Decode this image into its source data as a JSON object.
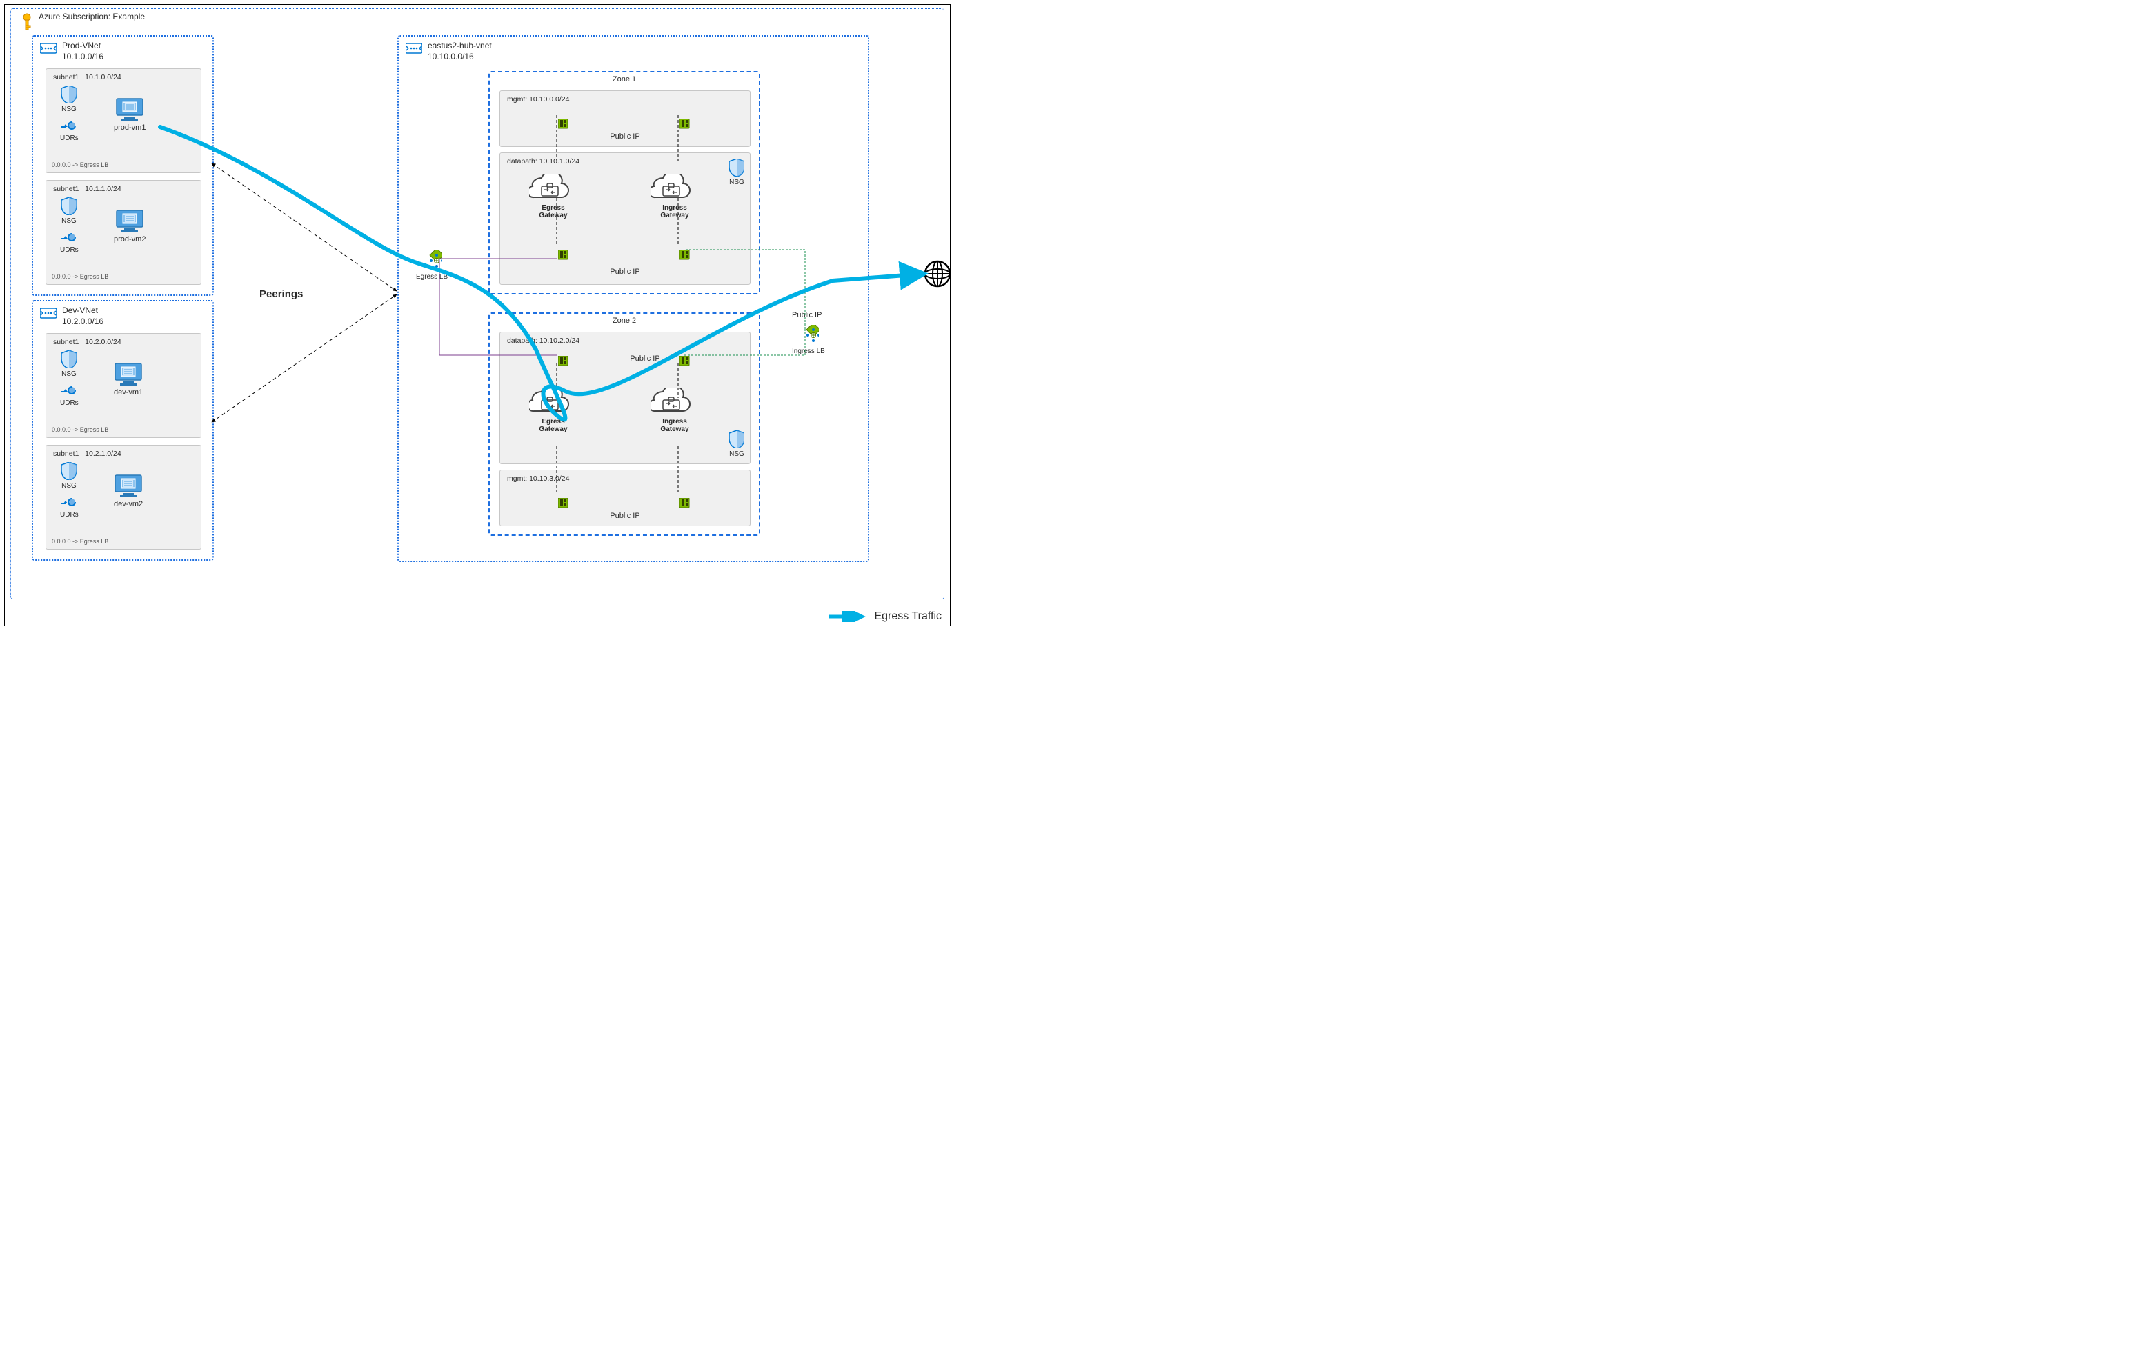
{
  "subscription": {
    "title": "Azure Subscription: Example"
  },
  "peerings_label": "Peerings",
  "legend_label": "Egress Traffic",
  "spoke_vnets": [
    {
      "name": "Prod-VNet",
      "cidr": "10.1.0.0/16",
      "subnets": [
        {
          "label": "subnet1",
          "cidr": "10.1.0.0/24",
          "nsg": "NSG",
          "udrs": "UDRs",
          "udr_note": "0.0.0.0 -> Egress LB",
          "vm": "prod-vm1"
        },
        {
          "label": "subnet1",
          "cidr": "10.1.1.0/24",
          "nsg": "NSG",
          "udrs": "UDRs",
          "udr_note": "0.0.0.0 -> Egress LB",
          "vm": "prod-vm2"
        }
      ]
    },
    {
      "name": "Dev-VNet",
      "cidr": "10.2.0.0/16",
      "subnets": [
        {
          "label": "subnet1",
          "cidr": "10.2.0.0/24",
          "nsg": "NSG",
          "udrs": "UDRs",
          "udr_note": "0.0.0.0 -> Egress LB",
          "vm": "dev-vm1"
        },
        {
          "label": "subnet1",
          "cidr": "10.2.1.0/24",
          "nsg": "NSG",
          "udrs": "UDRs",
          "udr_note": "0.0.0.0 -> Egress LB",
          "vm": "dev-vm2"
        }
      ]
    }
  ],
  "hub_vnet": {
    "name": "eastus2-hub-vnet",
    "cidr": "10.10.0.0/16",
    "egress_lb": "Egress LB",
    "ingress_lb": "Ingress LB",
    "public_ip_label": "Public IP",
    "nsg_label": "NSG",
    "zones": [
      {
        "name": "Zone 1",
        "mgmt": {
          "label": "mgmt: 10.10.0.0/24",
          "pip": "Public IP"
        },
        "datapath": {
          "label": "datapath: 10.10.1.0/24",
          "pip": "Public IP",
          "egress_gw": "Egress\nGateway",
          "ingress_gw": "Ingress\nGateway"
        }
      },
      {
        "name": "Zone 2",
        "datapath": {
          "label": "datapath: 10.10.2.0/24",
          "pip": "Public IP",
          "egress_gw": "Egress\nGateway",
          "ingress_gw": "Ingress\nGateway"
        },
        "mgmt": {
          "label": "mgmt: 10.10.3.0/24",
          "pip": "Public IP"
        }
      }
    ]
  }
}
